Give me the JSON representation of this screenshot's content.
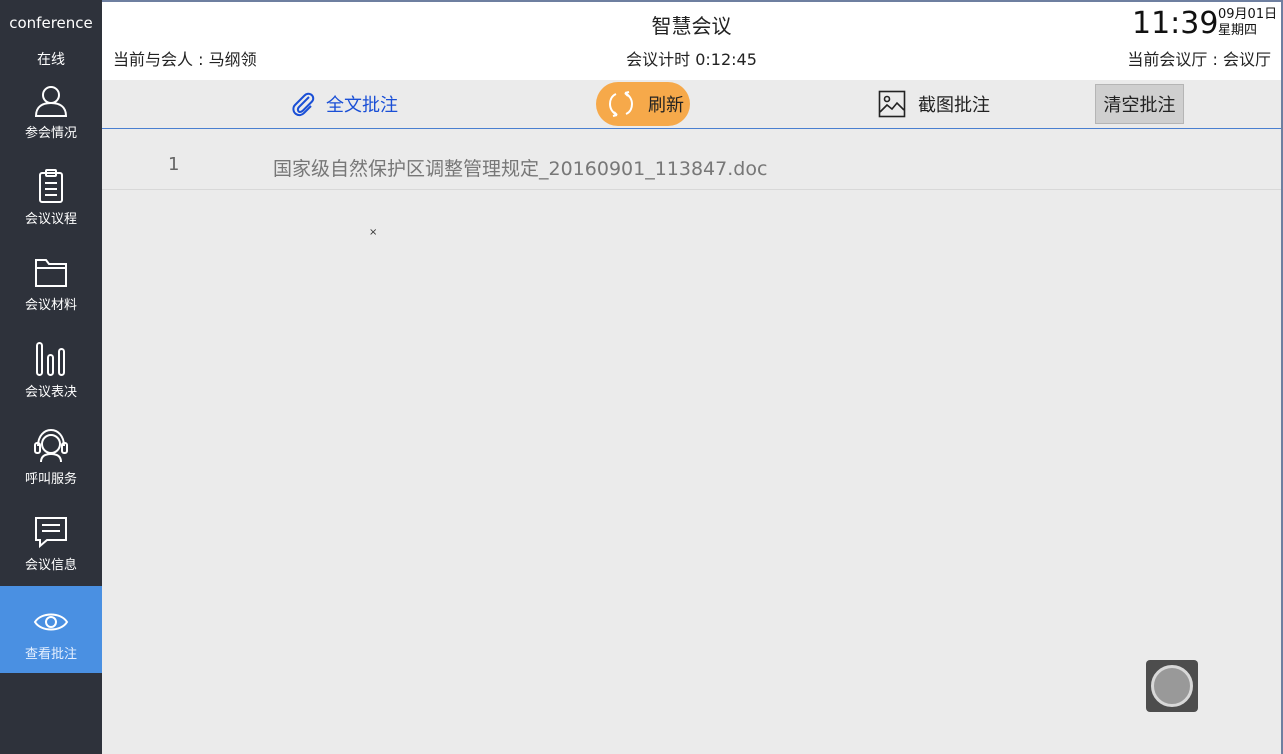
{
  "sidebar": {
    "brand": "conference",
    "status": "在线",
    "items": [
      {
        "label": "参会情况",
        "icon": "person-icon"
      },
      {
        "label": "会议议程",
        "icon": "clipboard-icon"
      },
      {
        "label": "会议材料",
        "icon": "folder-icon"
      },
      {
        "label": "会议表决",
        "icon": "bar-chart-icon"
      },
      {
        "label": "呼叫服务",
        "icon": "headset-icon"
      },
      {
        "label": "会议信息",
        "icon": "message-icon"
      },
      {
        "label": "查看批注",
        "icon": "eye-icon",
        "active": true
      }
    ]
  },
  "header": {
    "title": "智慧会议",
    "attendee": "当前与会人 : 马纲领",
    "timer": "会议计时  0:12:45",
    "clock": "11:39",
    "date": "09月01日",
    "weekday": "星期四",
    "room": "当前会议厅 : 会议厅"
  },
  "toolbar": {
    "full_annotation": "全文批注",
    "refresh": "刷新",
    "screenshot_annotation": "截图批注",
    "clear_annotation": "清空批注"
  },
  "files": [
    {
      "index": "1",
      "name": "国家级自然保护区调整管理规定_20160901_113847.doc"
    }
  ],
  "colors": {
    "sidebar_bg": "#2e323b",
    "active_item": "#4a90e2",
    "refresh_button": "#f6a94a",
    "link_blue": "#1a4fd6"
  }
}
